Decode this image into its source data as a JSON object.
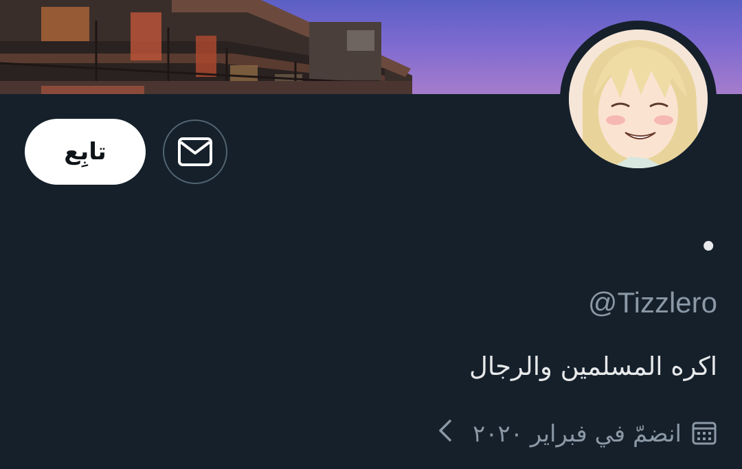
{
  "profile": {
    "display_name": "•",
    "handle": "@Tizzlero",
    "bio": "اكره المسلمين والرجال",
    "joined": "انضمّ في فبراير ٢٠٢٠"
  },
  "actions": {
    "follow_label": "تابِع"
  },
  "icons": {
    "message": "envelope-icon",
    "joined": "calendar-icon",
    "more": "chevron-left-icon"
  },
  "colors": {
    "background": "#15202b",
    "primary_text": "#e7e9ea",
    "secondary_text": "#8b98a5",
    "button_bg": "#ffffff",
    "button_border": "#536471"
  }
}
